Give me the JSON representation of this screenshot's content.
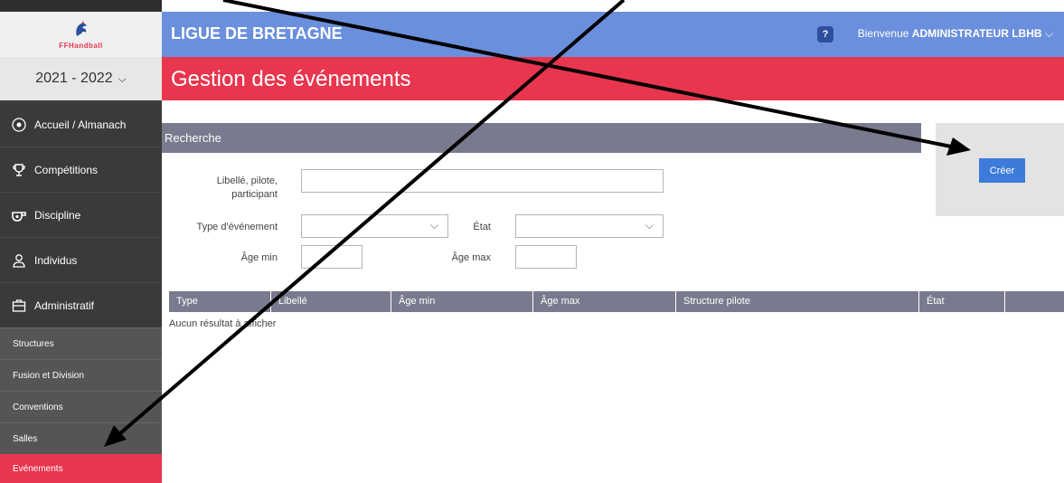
{
  "logo": {
    "text": "FFHandball"
  },
  "season": {
    "label": "2021 - 2022",
    "chevron": "chevron-down-icon"
  },
  "sidebar": {
    "items": [
      {
        "label": "Accueil / Almanach",
        "icon": "radio-icon"
      },
      {
        "label": "Compétitions",
        "icon": "trophy-icon"
      },
      {
        "label": "Discipline",
        "icon": "whistle-icon"
      },
      {
        "label": "Individus",
        "icon": "user-icon"
      },
      {
        "label": "Administratif",
        "icon": "briefcase-icon"
      }
    ],
    "subitems": [
      {
        "label": "Structures"
      },
      {
        "label": "Fusion et Division"
      },
      {
        "label": "Conventions"
      },
      {
        "label": "Salles"
      },
      {
        "label": "Evénements"
      }
    ]
  },
  "header": {
    "org": "LIGUE DE BRETAGNE",
    "help": "?",
    "welcome_prefix": "Bienvenue ",
    "user": "ADMINISTRATEUR LBHB"
  },
  "page": {
    "title": "Gestion des événements"
  },
  "search": {
    "heading": "Recherche",
    "libelle_label": "Libellé, pilote, participant",
    "type_label": "Type d'événement",
    "etat_label": "État",
    "age_min_label": "Âge min",
    "age_max_label": "Âge max"
  },
  "create": {
    "label": "Créer"
  },
  "table": {
    "columns": [
      "Type",
      "Libellé",
      "Âge min",
      "Âge max",
      "Structure pilote",
      "État",
      ""
    ],
    "empty": "Aucun résultat à afficher"
  },
  "colors": {
    "header": "#6a8fdc",
    "accent": "#e8364e",
    "sidebar": "#3a3a3a",
    "button": "#3c7bd9"
  }
}
